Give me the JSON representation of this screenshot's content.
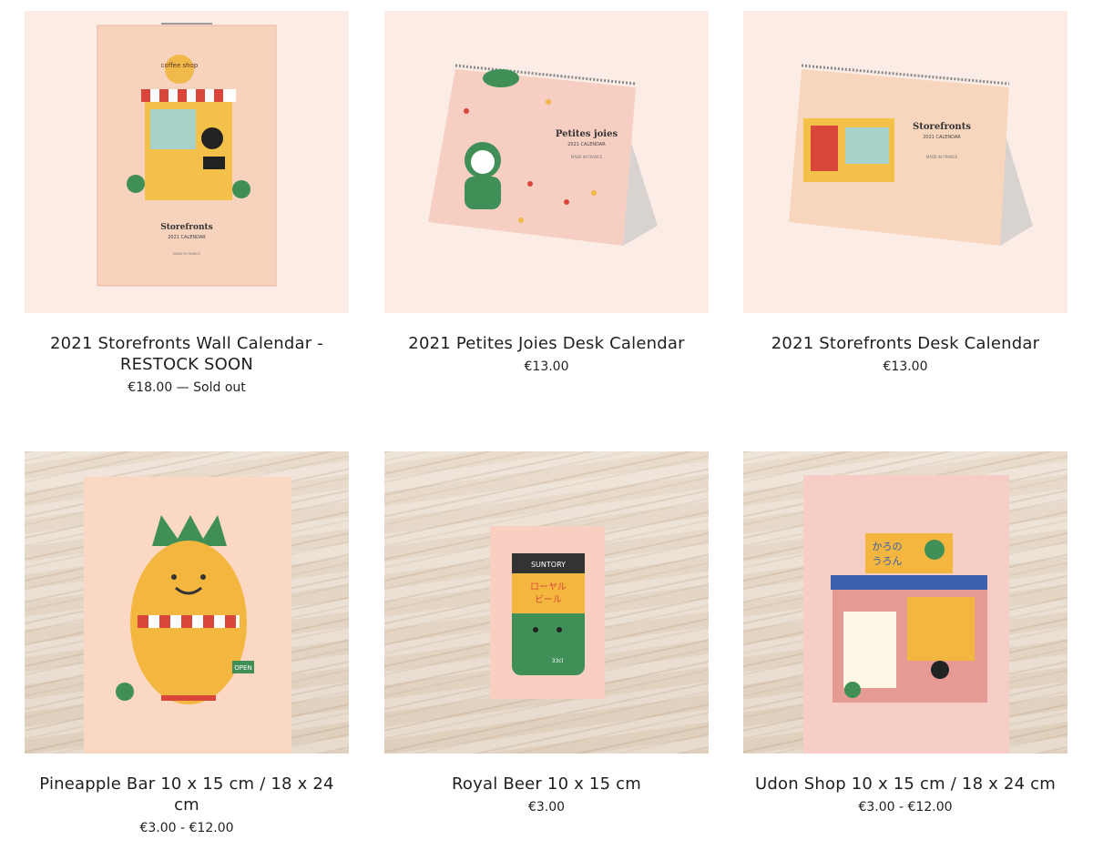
{
  "products": [
    {
      "title_line1": "2021 Storefronts Wall Calendar -",
      "title_line2": "RESTOCK SOON",
      "price": "€18.00 — Sold out",
      "image_text": {
        "sign": "coffee shop",
        "name": "Storefronts",
        "sub": "2021 CALENDAR",
        "made": "MADE IN FRANCE"
      }
    },
    {
      "title": "2021 Petites Joies Desk Calendar",
      "price": "€13.00",
      "image_text": {
        "name": "Petites joies",
        "sub": "2021 CALENDAR",
        "made": "MADE IN FRANCE"
      }
    },
    {
      "title": "2021 Storefronts Desk Calendar",
      "price": "€13.00",
      "image_text": {
        "name": "Storefronts",
        "sub": "2021 CALENDAR",
        "made": "MADE IN FRANCE"
      }
    },
    {
      "title": "Pineapple Bar 10 x 15 cm / 18 x 24 cm",
      "price": "€3.00 - €12.00",
      "image_text": {
        "sign": "OPEN"
      }
    },
    {
      "title": "Royal Beer 10 x 15 cm",
      "price": "€3.00",
      "image_text": {
        "brand": "SUNTORY",
        "label1": "ローヤル",
        "label2": "ビール",
        "volume": "33cl"
      }
    },
    {
      "title": "Udon Shop 10 x 15 cm / 18 x 24 cm",
      "price": "€3.00 - €12.00",
      "image_text": {
        "sign1": "かろの",
        "sign2": "うろん"
      }
    }
  ],
  "colors": {
    "accent_red": "#d9473a",
    "frog_green": "#3f8f57",
    "paper_pink": "#f7c8b6"
  }
}
